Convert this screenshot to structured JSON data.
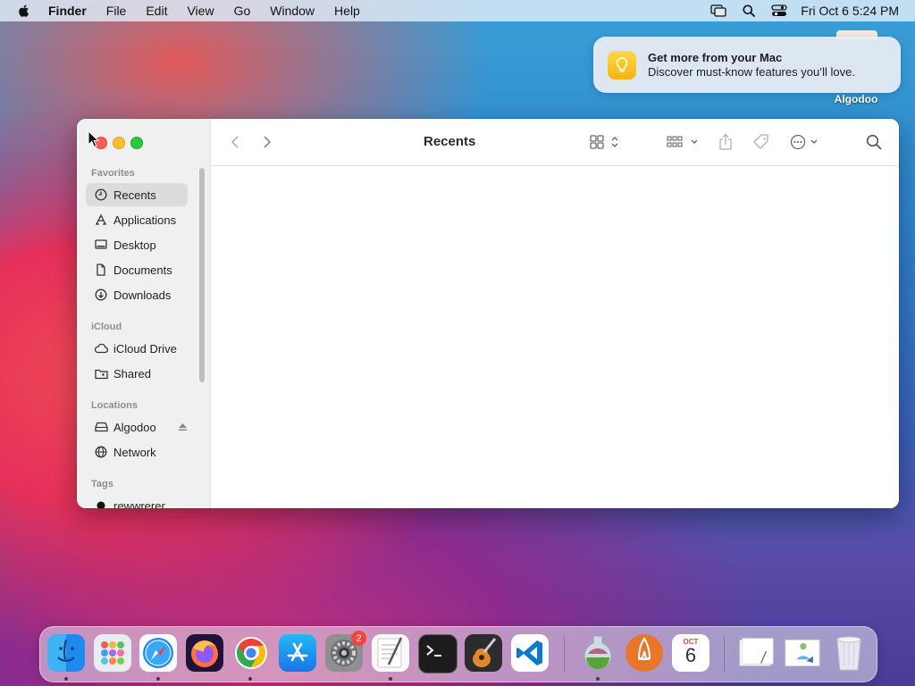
{
  "menubar": {
    "app_name": "Finder",
    "menus": [
      "File",
      "Edit",
      "View",
      "Go",
      "Window",
      "Help"
    ],
    "clock": "Fri Oct 6  5:24 PM"
  },
  "notification": {
    "title": "Get more from your Mac",
    "body": "Discover must-know features you’ll love."
  },
  "desktop": {
    "icon_label": "Algodoo"
  },
  "finder": {
    "title": "Recents",
    "sections": {
      "favorites": "Favorites",
      "icloud": "iCloud",
      "locations": "Locations",
      "tags": "Tags"
    },
    "favorites": [
      "Recents",
      "Applications",
      "Desktop",
      "Documents",
      "Downloads"
    ],
    "icloud": [
      "iCloud Drive",
      "Shared"
    ],
    "locations": [
      "Algodoo",
      "Network"
    ],
    "tags": [
      "rewwrerer"
    ]
  },
  "dock": {
    "apps": [
      "Finder",
      "Launchpad",
      "Safari",
      "Firefox",
      "Chrome",
      "App Store",
      "System Settings",
      "TextEdit",
      "Terminal",
      "GarageBand",
      "Visual Studio Code",
      "Algodoo",
      "Vectorworks",
      "Calendar",
      "Documents stack",
      "Preview",
      "Trash"
    ],
    "settings_badge": "2",
    "calendar_month": "OCT",
    "calendar_day": "6"
  }
}
